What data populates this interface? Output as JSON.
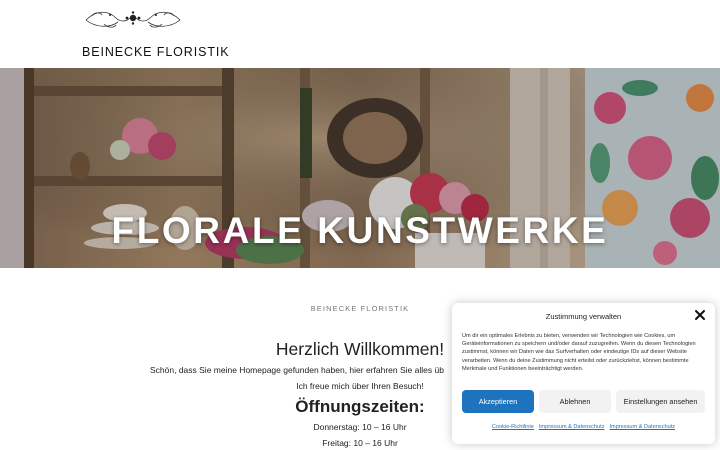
{
  "header": {
    "logo": "ornamental-flourish-logo",
    "site_title": "BEINECKE FLORISTIK"
  },
  "hero": {
    "title": "FLORALE KUNSTWERKE",
    "slides_total": 4,
    "active_slide": 1
  },
  "content": {
    "eyebrow": "BEINECKE FLORISTIK",
    "welcome": "Herzlich Willkommen!",
    "intro": "Schön, dass Sie meine Homepage gefunden haben, hier erfahren Sie alles üb",
    "thanks": "Ich freue mich über Ihren Besuch!",
    "hours_title": "Öffnungszeiten:",
    "hours": [
      "Donnerstag:  10 – 16 Uhr",
      "Freitag:  10 – 16 Uhr"
    ]
  },
  "consent": {
    "title": "Zustimmung verwalten",
    "text": "Um dir ein optimales Erlebnis zu bieten, verwenden wir Technologien wie Cookies, um Geräteinformationen zu speichern und/oder darauf zuzugreifen. Wenn du diesen Technologien zustimmst, können wir Daten wie das Surfverhalten oder eindeutige IDs auf dieser Website verarbeiten. Wenn du deine Zustimmung nicht erteilst oder zurückziehst, können bestimmte Merkmale und Funktionen beeinträchtigt werden.",
    "accept_label": "Akzeptieren",
    "deny_label": "Ablehnen",
    "settings_label": "Einstellungen ansehen",
    "links": [
      "Cookie-Richtlinie",
      "Impressum & Datenschutz",
      "Impressum & Datenschutz"
    ]
  },
  "colors": {
    "accent": "#1e73be",
    "button_secondary": "#f2f2f2"
  }
}
